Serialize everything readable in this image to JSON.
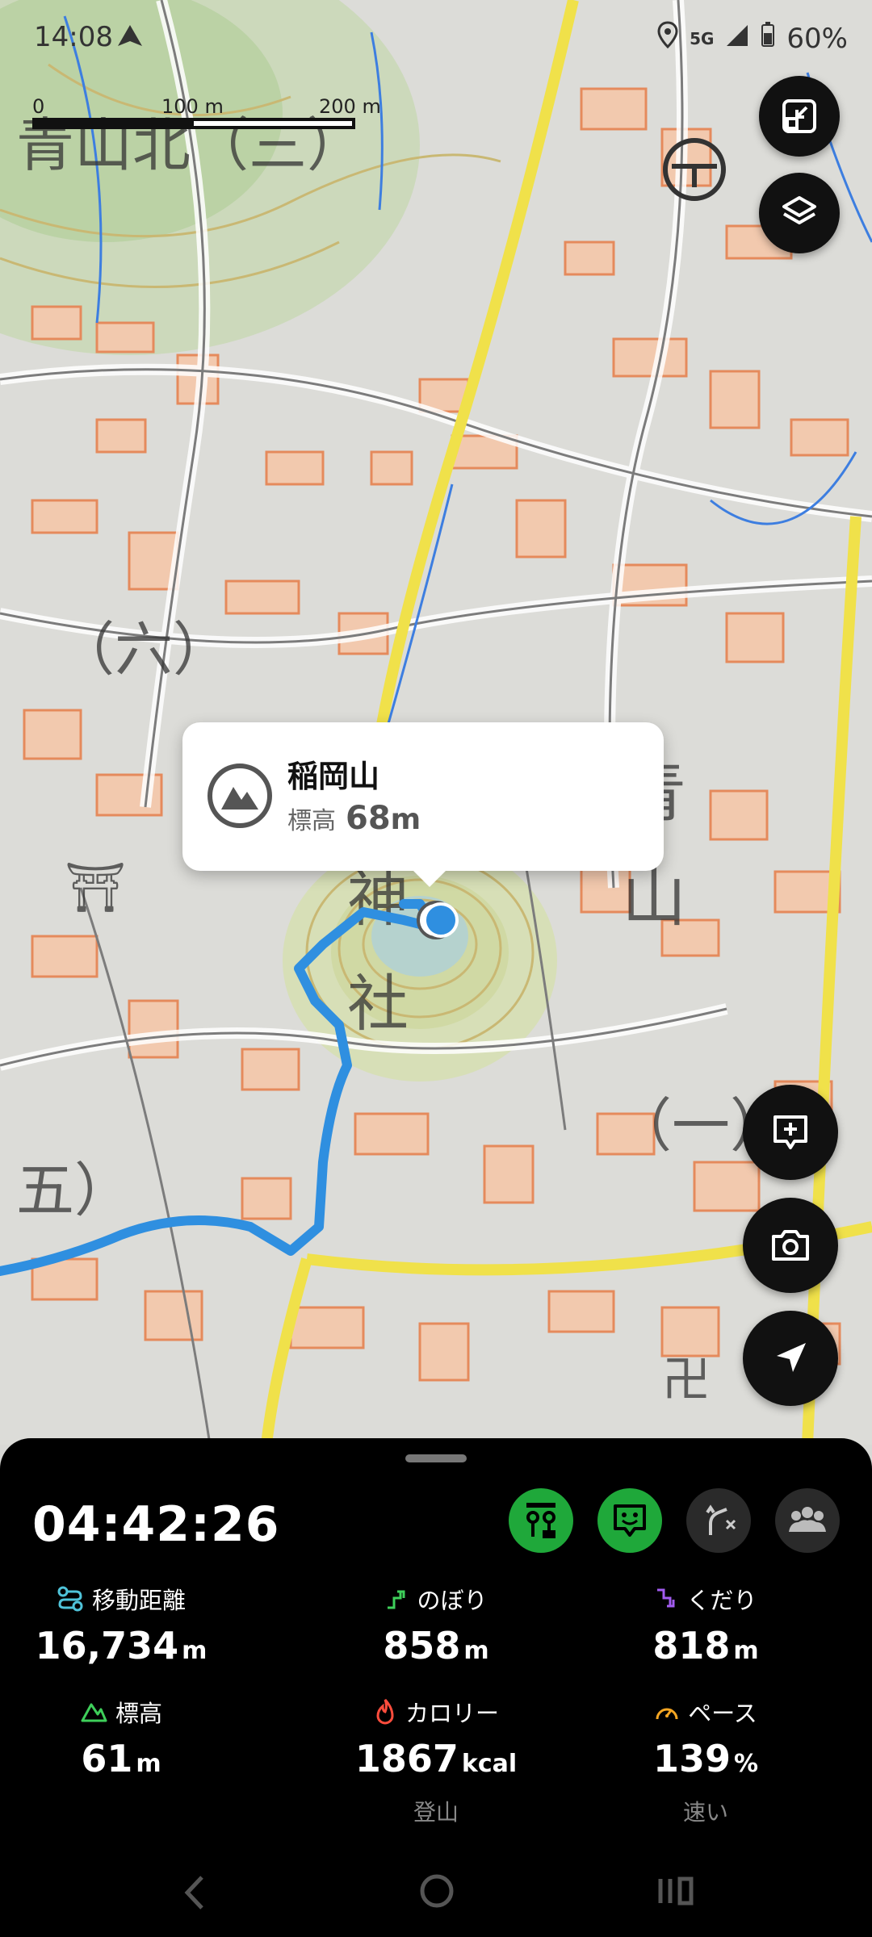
{
  "status_bar": {
    "time": "14:08",
    "network": "5G",
    "battery": "60%"
  },
  "scale": {
    "label_0": "0",
    "label_100": "100 m",
    "label_200": "200 m"
  },
  "map": {
    "labels": [
      "青山北（三）",
      "（六）",
      "五）",
      "青",
      "山",
      "（一）",
      "神",
      "社",
      "卍",
      "⛩"
    ]
  },
  "popup": {
    "name": "稲岡山",
    "elevation_label": "標高",
    "elevation_value": "68",
    "elevation_unit": "m"
  },
  "sheet": {
    "elapsed_time": "04:42:26",
    "stats": [
      {
        "label": "移動距離",
        "value": "16,734",
        "unit": "m",
        "sub": "",
        "icon": "route-icon",
        "color": "#4fc3d9"
      },
      {
        "label": "のぼり",
        "value": "858",
        "unit": "m",
        "sub": "",
        "icon": "ascent-icon",
        "color": "#3ecf5a"
      },
      {
        "label": "くだり",
        "value": "818",
        "unit": "m",
        "sub": "",
        "icon": "descent-icon",
        "color": "#a25cf0"
      },
      {
        "label": "標高",
        "value": "61",
        "unit": "m",
        "sub": "",
        "icon": "mountain-icon",
        "color": "#3ecf5a"
      },
      {
        "label": "カロリー",
        "value": "1867",
        "unit": "kcal",
        "sub": "登山",
        "icon": "flame-icon",
        "color": "#ff4d3d"
      },
      {
        "label": "ペース",
        "value": "139",
        "unit": "%",
        "sub": "速い",
        "icon": "speedometer-icon",
        "color": "#f5a623"
      }
    ]
  },
  "colors": {
    "track": "#2f8fe0",
    "accent_green": "#1fa83a",
    "sheet_bg": "#000000"
  }
}
